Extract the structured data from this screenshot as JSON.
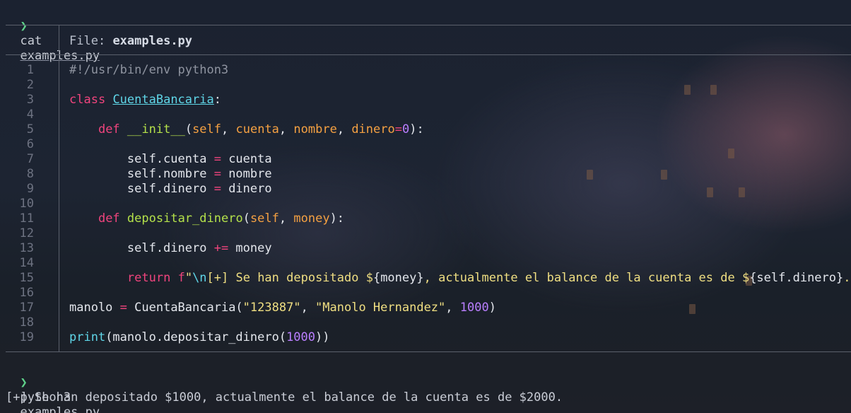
{
  "terminal": {
    "prompt_symbol": "❯",
    "commands": [
      {
        "command": "cat",
        "argument": "examples.py"
      },
      {
        "command": "python3",
        "argument": "examples.py"
      }
    ],
    "file_header_label": "File:",
    "file_header_name": "examples.py",
    "output": "[+] Se han depositado $1000, actualmente el balance de la cuenta es de $2000."
  },
  "code_lines": [
    {
      "n": "1",
      "tokens": [
        {
          "t": "#!/usr/bin/env python3",
          "c": "comment"
        }
      ]
    },
    {
      "n": "2",
      "tokens": []
    },
    {
      "n": "3",
      "tokens": [
        {
          "t": "class",
          "c": "kw"
        },
        {
          "t": " ",
          "c": "punc"
        },
        {
          "t": "CuentaBancaria",
          "c": "cls"
        },
        {
          "t": ":",
          "c": "punc"
        }
      ]
    },
    {
      "n": "4",
      "tokens": []
    },
    {
      "n": "5",
      "tokens": [
        {
          "t": "    ",
          "c": "punc"
        },
        {
          "t": "def",
          "c": "kw"
        },
        {
          "t": " ",
          "c": "punc"
        },
        {
          "t": "__init__",
          "c": "fn"
        },
        {
          "t": "(",
          "c": "punc"
        },
        {
          "t": "self",
          "c": "param"
        },
        {
          "t": ", ",
          "c": "punc"
        },
        {
          "t": "cuenta",
          "c": "param"
        },
        {
          "t": ", ",
          "c": "punc"
        },
        {
          "t": "nombre",
          "c": "param"
        },
        {
          "t": ", ",
          "c": "punc"
        },
        {
          "t": "dinero",
          "c": "param"
        },
        {
          "t": "=",
          "c": "op"
        },
        {
          "t": "0",
          "c": "num"
        },
        {
          "t": "):",
          "c": "punc"
        }
      ]
    },
    {
      "n": "6",
      "tokens": []
    },
    {
      "n": "7",
      "tokens": [
        {
          "t": "        self.cuenta ",
          "c": "punc"
        },
        {
          "t": "=",
          "c": "op"
        },
        {
          "t": " cuenta",
          "c": "punc"
        }
      ]
    },
    {
      "n": "8",
      "tokens": [
        {
          "t": "        self.nombre ",
          "c": "punc"
        },
        {
          "t": "=",
          "c": "op"
        },
        {
          "t": " nombre",
          "c": "punc"
        }
      ]
    },
    {
      "n": "9",
      "tokens": [
        {
          "t": "        self.dinero ",
          "c": "punc"
        },
        {
          "t": "=",
          "c": "op"
        },
        {
          "t": " dinero",
          "c": "punc"
        }
      ]
    },
    {
      "n": "10",
      "tokens": []
    },
    {
      "n": "11",
      "tokens": [
        {
          "t": "    ",
          "c": "punc"
        },
        {
          "t": "def",
          "c": "kw"
        },
        {
          "t": " ",
          "c": "punc"
        },
        {
          "t": "depositar_dinero",
          "c": "fn"
        },
        {
          "t": "(",
          "c": "punc"
        },
        {
          "t": "self",
          "c": "param"
        },
        {
          "t": ", ",
          "c": "punc"
        },
        {
          "t": "money",
          "c": "param"
        },
        {
          "t": "):",
          "c": "punc"
        }
      ]
    },
    {
      "n": "12",
      "tokens": []
    },
    {
      "n": "13",
      "tokens": [
        {
          "t": "        self.dinero ",
          "c": "punc"
        },
        {
          "t": "+=",
          "c": "op"
        },
        {
          "t": " money",
          "c": "punc"
        }
      ]
    },
    {
      "n": "14",
      "tokens": []
    },
    {
      "n": "15",
      "tokens": [
        {
          "t": "        ",
          "c": "punc"
        },
        {
          "t": "return",
          "c": "kw"
        },
        {
          "t": " ",
          "c": "punc"
        },
        {
          "t": "f",
          "c": "kw"
        },
        {
          "t": "\"",
          "c": "str"
        },
        {
          "t": "\\n",
          "c": "esc"
        },
        {
          "t": "[+] Se han depositado $",
          "c": "str"
        },
        {
          "t": "{money}",
          "c": "punc"
        },
        {
          "t": ", actualmente el balance de la cuenta es de $",
          "c": "str"
        },
        {
          "t": "{self.dinero}",
          "c": "punc"
        },
        {
          "t": ".\"",
          "c": "str"
        }
      ]
    },
    {
      "n": "16",
      "tokens": []
    },
    {
      "n": "17",
      "tokens": [
        {
          "t": "manolo ",
          "c": "punc"
        },
        {
          "t": "=",
          "c": "op"
        },
        {
          "t": " CuentaBancaria(",
          "c": "punc"
        },
        {
          "t": "\"123887\"",
          "c": "str"
        },
        {
          "t": ", ",
          "c": "punc"
        },
        {
          "t": "\"Manolo Hernandez\"",
          "c": "str"
        },
        {
          "t": ", ",
          "c": "punc"
        },
        {
          "t": "1000",
          "c": "num"
        },
        {
          "t": ")",
          "c": "punc"
        }
      ]
    },
    {
      "n": "18",
      "tokens": []
    },
    {
      "n": "19",
      "tokens": [
        {
          "t": "print",
          "c": "builtin"
        },
        {
          "t": "(manolo.depositar_dinero(",
          "c": "punc"
        },
        {
          "t": "1000",
          "c": "num"
        },
        {
          "t": "))",
          "c": "punc"
        }
      ]
    }
  ],
  "colors": {
    "prompt": "#5fd28a",
    "keyword": "#f0447d",
    "class_name": "#5fd6e8",
    "function_name": "#b4e14a",
    "parameter": "#f5a142",
    "number": "#ba7fff",
    "string": "#f0df82",
    "comment": "#8f94a0"
  }
}
